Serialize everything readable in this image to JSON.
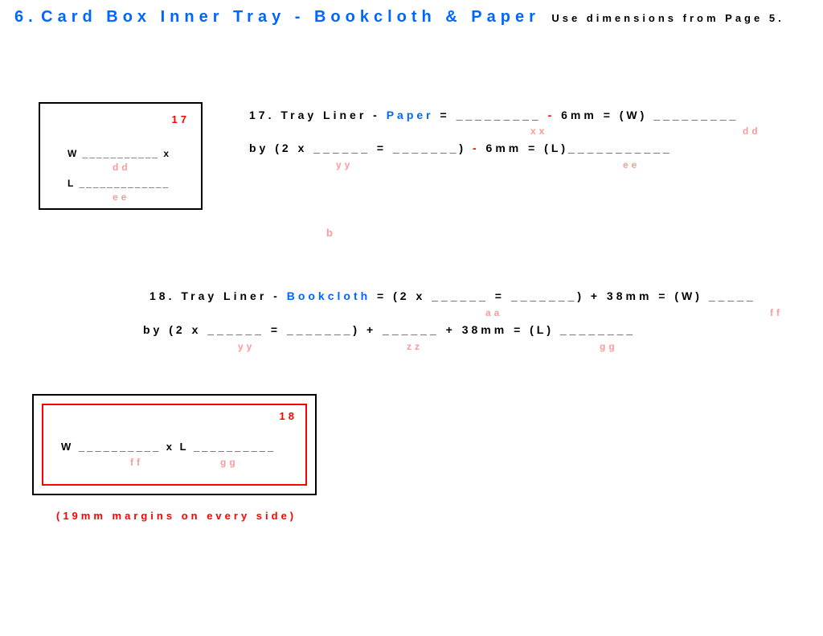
{
  "header": {
    "section": "6.",
    "title": "Card Box Inner Tray - Bookcloth & Paper",
    "note": "Use dimensions from Page 5."
  },
  "box17": {
    "number": "17",
    "w_line": "W ___________  x",
    "w_sub": "dd",
    "l_line": "L _____________",
    "l_sub": "ee"
  },
  "f17": {
    "line1_a": "17. Tray Liner - ",
    "line1_paper": "Paper",
    "line1_b": " =  _________ ",
    "line1_minus": "-",
    "line1_c": " 6mm = (W) _________",
    "sub_xx": "xx",
    "sub_dd": "dd",
    "line2_a": "by ",
    "line2_b": "(2 x ______ = _______)",
    "line2_minus": " - ",
    "line2_c": "6mm =  (L)___________",
    "sub_yy": "yy",
    "sub_ee": "ee"
  },
  "loose_b": "b",
  "f18": {
    "line1_a": "18. Tray Liner - ",
    "line1_bookcloth": "Bookcloth",
    "line1_b": " = (2 x ______ = _______) + 38mm = (W) _____",
    "sub_aa": "aa",
    "sub_ff": "ff",
    "line2": "by (2 x ______ = _______) + ______ + 38mm = (L) ________",
    "sub_yy": "yy",
    "sub_zz": "zz",
    "sub_gg": "gg"
  },
  "box18": {
    "number": "18",
    "wl": "W __________ x  L __________",
    "sub_ff": "ff",
    "sub_gg": "gg"
  },
  "margins": "(19mm margins on every side)"
}
